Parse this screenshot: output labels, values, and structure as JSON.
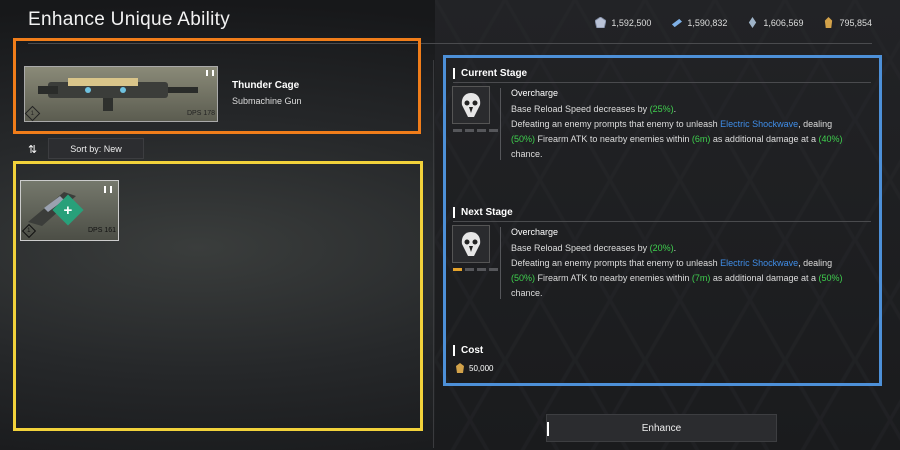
{
  "header": {
    "title": "Enhance Unique Ability",
    "currencies": [
      {
        "icon": "crystal-currency-icon",
        "value": "1,592,500"
      },
      {
        "icon": "ticket-currency-icon",
        "value": "1,590,832"
      },
      {
        "icon": "shard-currency-icon",
        "value": "1,606,569"
      },
      {
        "icon": "gold-currency-icon",
        "value": "795,854"
      }
    ]
  },
  "selected_weapon": {
    "name": "Thunder Cage",
    "type": "Submachine Gun",
    "dps": "DPS 178",
    "rank": "1"
  },
  "sort": {
    "label": "Sort by: New"
  },
  "inventory": [
    {
      "dps": "DPS 161",
      "rank": "1"
    }
  ],
  "current_stage": {
    "title": "Current Stage",
    "ability_name": "Overcharge",
    "line1_prefix": "Base Reload Speed decreases by ",
    "line1_value": "(25%)",
    "line1_suffix": ".",
    "line2_prefix": "Defeating an enemy prompts that enemy to unleash ",
    "line2_link": "Electric Shockwave",
    "line2_suffix": ", dealing",
    "line3_v1": "(50%)",
    "line3_mid": " Firearm ATK to nearby enemies within ",
    "line3_v2": "(6m)",
    "line3_mid2": " as additional damage at a ",
    "line3_v3": "(40%)",
    "line4": "chance.",
    "pips_active": 0
  },
  "next_stage": {
    "title": "Next Stage",
    "ability_name": "Overcharge",
    "line1_prefix": "Base Reload Speed decreases by ",
    "line1_value": "(20%)",
    "line1_suffix": ".",
    "line2_prefix": "Defeating an enemy prompts that enemy to unleash ",
    "line2_link": "Electric Shockwave",
    "line2_suffix": ", dealing",
    "line3_v1": "(50%)",
    "line3_mid": " Firearm ATK to nearby enemies within ",
    "line3_v2": "(7m)",
    "line3_mid2": " as additional damage at a ",
    "line3_v3": "(50%)",
    "line4": "chance.",
    "pips_active": 1
  },
  "cost": {
    "title": "Cost",
    "value": "50,000",
    "icon": "gold-currency-icon"
  },
  "enhance_button": {
    "label": "Enhance"
  },
  "colors": {
    "selected_frame": "#f07d1a",
    "inventory_frame": "#f2d23b",
    "info_frame": "#4d90d8",
    "value_green": "#3fcf4e",
    "link_blue": "#3f8de8",
    "pip_active": "#e5a32c"
  }
}
